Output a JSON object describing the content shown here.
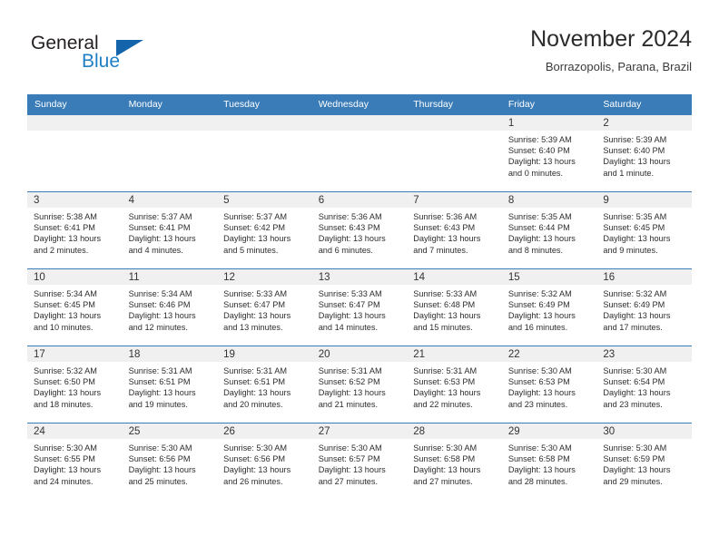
{
  "brand": {
    "name_dark": "General",
    "name_blue": "Blue",
    "triangle_icon": "triangle-icon",
    "accent_color": "#1464ab",
    "blue_text_color": "#1f7fc4"
  },
  "header": {
    "title": "November 2024",
    "subtitle": "Borrazopolis, Parana, Brazil"
  },
  "calendar": {
    "header_bg": "#3a7cb8",
    "daynum_bg": "#f0f0f0",
    "weekdays": [
      "Sunday",
      "Monday",
      "Tuesday",
      "Wednesday",
      "Thursday",
      "Friday",
      "Saturday"
    ],
    "weeks": [
      [
        {
          "day": "",
          "sunrise": "",
          "sunset": "",
          "daylight": ""
        },
        {
          "day": "",
          "sunrise": "",
          "sunset": "",
          "daylight": ""
        },
        {
          "day": "",
          "sunrise": "",
          "sunset": "",
          "daylight": ""
        },
        {
          "day": "",
          "sunrise": "",
          "sunset": "",
          "daylight": ""
        },
        {
          "day": "",
          "sunrise": "",
          "sunset": "",
          "daylight": ""
        },
        {
          "day": "1",
          "sunrise": "Sunrise: 5:39 AM",
          "sunset": "Sunset: 6:40 PM",
          "daylight": "Daylight: 13 hours and 0 minutes."
        },
        {
          "day": "2",
          "sunrise": "Sunrise: 5:39 AM",
          "sunset": "Sunset: 6:40 PM",
          "daylight": "Daylight: 13 hours and 1 minute."
        }
      ],
      [
        {
          "day": "3",
          "sunrise": "Sunrise: 5:38 AM",
          "sunset": "Sunset: 6:41 PM",
          "daylight": "Daylight: 13 hours and 2 minutes."
        },
        {
          "day": "4",
          "sunrise": "Sunrise: 5:37 AM",
          "sunset": "Sunset: 6:41 PM",
          "daylight": "Daylight: 13 hours and 4 minutes."
        },
        {
          "day": "5",
          "sunrise": "Sunrise: 5:37 AM",
          "sunset": "Sunset: 6:42 PM",
          "daylight": "Daylight: 13 hours and 5 minutes."
        },
        {
          "day": "6",
          "sunrise": "Sunrise: 5:36 AM",
          "sunset": "Sunset: 6:43 PM",
          "daylight": "Daylight: 13 hours and 6 minutes."
        },
        {
          "day": "7",
          "sunrise": "Sunrise: 5:36 AM",
          "sunset": "Sunset: 6:43 PM",
          "daylight": "Daylight: 13 hours and 7 minutes."
        },
        {
          "day": "8",
          "sunrise": "Sunrise: 5:35 AM",
          "sunset": "Sunset: 6:44 PM",
          "daylight": "Daylight: 13 hours and 8 minutes."
        },
        {
          "day": "9",
          "sunrise": "Sunrise: 5:35 AM",
          "sunset": "Sunset: 6:45 PM",
          "daylight": "Daylight: 13 hours and 9 minutes."
        }
      ],
      [
        {
          "day": "10",
          "sunrise": "Sunrise: 5:34 AM",
          "sunset": "Sunset: 6:45 PM",
          "daylight": "Daylight: 13 hours and 10 minutes."
        },
        {
          "day": "11",
          "sunrise": "Sunrise: 5:34 AM",
          "sunset": "Sunset: 6:46 PM",
          "daylight": "Daylight: 13 hours and 12 minutes."
        },
        {
          "day": "12",
          "sunrise": "Sunrise: 5:33 AM",
          "sunset": "Sunset: 6:47 PM",
          "daylight": "Daylight: 13 hours and 13 minutes."
        },
        {
          "day": "13",
          "sunrise": "Sunrise: 5:33 AM",
          "sunset": "Sunset: 6:47 PM",
          "daylight": "Daylight: 13 hours and 14 minutes."
        },
        {
          "day": "14",
          "sunrise": "Sunrise: 5:33 AM",
          "sunset": "Sunset: 6:48 PM",
          "daylight": "Daylight: 13 hours and 15 minutes."
        },
        {
          "day": "15",
          "sunrise": "Sunrise: 5:32 AM",
          "sunset": "Sunset: 6:49 PM",
          "daylight": "Daylight: 13 hours and 16 minutes."
        },
        {
          "day": "16",
          "sunrise": "Sunrise: 5:32 AM",
          "sunset": "Sunset: 6:49 PM",
          "daylight": "Daylight: 13 hours and 17 minutes."
        }
      ],
      [
        {
          "day": "17",
          "sunrise": "Sunrise: 5:32 AM",
          "sunset": "Sunset: 6:50 PM",
          "daylight": "Daylight: 13 hours and 18 minutes."
        },
        {
          "day": "18",
          "sunrise": "Sunrise: 5:31 AM",
          "sunset": "Sunset: 6:51 PM",
          "daylight": "Daylight: 13 hours and 19 minutes."
        },
        {
          "day": "19",
          "sunrise": "Sunrise: 5:31 AM",
          "sunset": "Sunset: 6:51 PM",
          "daylight": "Daylight: 13 hours and 20 minutes."
        },
        {
          "day": "20",
          "sunrise": "Sunrise: 5:31 AM",
          "sunset": "Sunset: 6:52 PM",
          "daylight": "Daylight: 13 hours and 21 minutes."
        },
        {
          "day": "21",
          "sunrise": "Sunrise: 5:31 AM",
          "sunset": "Sunset: 6:53 PM",
          "daylight": "Daylight: 13 hours and 22 minutes."
        },
        {
          "day": "22",
          "sunrise": "Sunrise: 5:30 AM",
          "sunset": "Sunset: 6:53 PM",
          "daylight": "Daylight: 13 hours and 23 minutes."
        },
        {
          "day": "23",
          "sunrise": "Sunrise: 5:30 AM",
          "sunset": "Sunset: 6:54 PM",
          "daylight": "Daylight: 13 hours and 23 minutes."
        }
      ],
      [
        {
          "day": "24",
          "sunrise": "Sunrise: 5:30 AM",
          "sunset": "Sunset: 6:55 PM",
          "daylight": "Daylight: 13 hours and 24 minutes."
        },
        {
          "day": "25",
          "sunrise": "Sunrise: 5:30 AM",
          "sunset": "Sunset: 6:56 PM",
          "daylight": "Daylight: 13 hours and 25 minutes."
        },
        {
          "day": "26",
          "sunrise": "Sunrise: 5:30 AM",
          "sunset": "Sunset: 6:56 PM",
          "daylight": "Daylight: 13 hours and 26 minutes."
        },
        {
          "day": "27",
          "sunrise": "Sunrise: 5:30 AM",
          "sunset": "Sunset: 6:57 PM",
          "daylight": "Daylight: 13 hours and 27 minutes."
        },
        {
          "day": "28",
          "sunrise": "Sunrise: 5:30 AM",
          "sunset": "Sunset: 6:58 PM",
          "daylight": "Daylight: 13 hours and 27 minutes."
        },
        {
          "day": "29",
          "sunrise": "Sunrise: 5:30 AM",
          "sunset": "Sunset: 6:58 PM",
          "daylight": "Daylight: 13 hours and 28 minutes."
        },
        {
          "day": "30",
          "sunrise": "Sunrise: 5:30 AM",
          "sunset": "Sunset: 6:59 PM",
          "daylight": "Daylight: 13 hours and 29 minutes."
        }
      ]
    ]
  }
}
